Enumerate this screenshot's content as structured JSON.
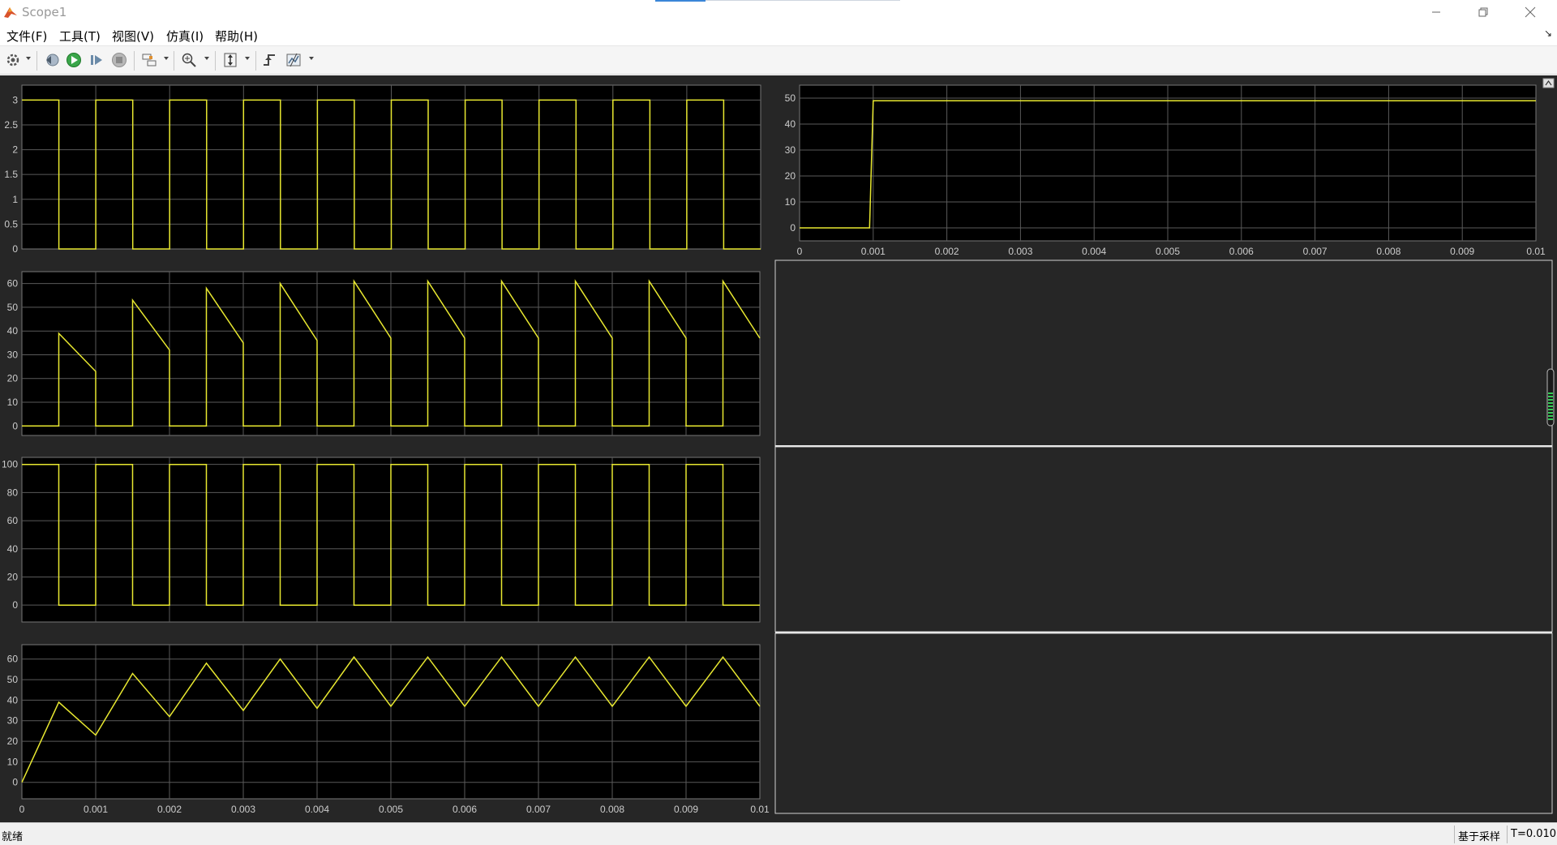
{
  "window": {
    "title": "Scope1"
  },
  "menu": [
    "文件(F)",
    "工具(T)",
    "视图(V)",
    "仿真(I)",
    "帮助(H)"
  ],
  "status": {
    "text": "就绪",
    "mode": "基于采样",
    "time": "T=0.010"
  },
  "colors": {
    "signal": "#e8e830",
    "axes_bg": "#000000",
    "grid": "#5a5a5a",
    "tick_text": "#cccccc",
    "figure_bg": "#262626"
  },
  "x_axis": {
    "range": [
      0,
      0.01
    ],
    "ticks": [
      "0",
      "0.001",
      "0.002",
      "0.003",
      "0.004",
      "0.005",
      "0.006",
      "0.007",
      "0.008",
      "0.009",
      "0.01"
    ]
  },
  "toolbar_icons": [
    "settings-icon",
    "step-back-icon",
    "run-icon",
    "step-forward-icon",
    "stop-icon",
    "highlight-icon",
    "zoom-icon",
    "autoscale-icon",
    "triggers-icon",
    "cursor-measure-icon"
  ],
  "chart_data": [
    {
      "type": "line",
      "description_kind": "square-wave",
      "yticks": [
        "0",
        "0.5",
        "1",
        "1.5",
        "2",
        "2.5",
        "3"
      ],
      "ylim": [
        0,
        3.3
      ],
      "x": [
        0,
        0.0005,
        0.0005,
        0.001,
        0.001,
        0.0015,
        0.0015,
        0.002,
        0.002,
        0.0025,
        0.0025,
        0.003,
        0.003,
        0.0035,
        0.0035,
        0.004,
        0.004,
        0.0045,
        0.0045,
        0.005,
        0.005,
        0.0055,
        0.0055,
        0.006,
        0.006,
        0.0065,
        0.0065,
        0.007,
        0.007,
        0.0075,
        0.0075,
        0.008,
        0.008,
        0.0085,
        0.0085,
        0.009,
        0.009,
        0.0095,
        0.0095,
        0.01
      ],
      "y": [
        3,
        3,
        0,
        0,
        3,
        3,
        0,
        0,
        3,
        3,
        0,
        0,
        3,
        3,
        0,
        0,
        3,
        3,
        0,
        0,
        3,
        3,
        0,
        0,
        3,
        3,
        0,
        0,
        3,
        3,
        0,
        0,
        3,
        3,
        0,
        0,
        3,
        3,
        0,
        0
      ]
    },
    {
      "type": "line",
      "yticks": [
        "0",
        "10",
        "20",
        "30",
        "40",
        "50",
        "60"
      ],
      "ylim": [
        -4,
        65
      ],
      "x": [
        0,
        0.0005,
        0.0005,
        0.001,
        0.001,
        0.0015,
        0.0015,
        0.002,
        0.002,
        0.0025,
        0.0025,
        0.003,
        0.003,
        0.0035,
        0.0035,
        0.004,
        0.004,
        0.0045,
        0.0045,
        0.005,
        0.005,
        0.0055,
        0.0055,
        0.006,
        0.006,
        0.0065,
        0.0065,
        0.007,
        0.007,
        0.0075,
        0.0075,
        0.008,
        0.008,
        0.0085,
        0.0085,
        0.009,
        0.009,
        0.0095,
        0.0095,
        0.01
      ],
      "y": [
        0,
        0,
        39,
        23,
        0,
        0,
        53,
        32,
        0,
        0,
        58,
        35,
        0,
        0,
        60,
        36,
        0,
        0,
        61,
        37,
        0,
        0,
        61,
        37,
        0,
        0,
        61,
        37,
        0,
        0,
        61,
        37,
        0,
        0,
        61,
        37,
        0,
        0,
        61,
        37
      ]
    },
    {
      "type": "line",
      "yticks": [
        "0",
        "20",
        "40",
        "60",
        "80",
        "100"
      ],
      "ylim": [
        -12,
        105
      ],
      "x": [
        0,
        0.0005,
        0.0005,
        0.001,
        0.001,
        0.0015,
        0.0015,
        0.002,
        0.002,
        0.0025,
        0.0025,
        0.003,
        0.003,
        0.0035,
        0.0035,
        0.004,
        0.004,
        0.0045,
        0.0045,
        0.005,
        0.005,
        0.0055,
        0.0055,
        0.006,
        0.006,
        0.0065,
        0.0065,
        0.007,
        0.007,
        0.0075,
        0.0075,
        0.008,
        0.008,
        0.0085,
        0.0085,
        0.009,
        0.009,
        0.0095,
        0.0095,
        0.01
      ],
      "y": [
        100,
        100,
        0,
        0,
        100,
        100,
        0,
        0,
        100,
        100,
        0,
        0,
        100,
        100,
        0,
        0,
        100,
        100,
        0,
        0,
        100,
        100,
        0,
        0,
        100,
        100,
        0,
        0,
        100,
        100,
        0,
        0,
        100,
        100,
        0,
        0,
        100,
        100,
        0,
        0
      ]
    },
    {
      "type": "line",
      "yticks": [
        "0",
        "10",
        "20",
        "30",
        "40",
        "50",
        "60"
      ],
      "ylim": [
        -8,
        67
      ],
      "show_xticks": true,
      "x": [
        0,
        0.0005,
        0.001,
        0.0015,
        0.002,
        0.0025,
        0.003,
        0.0035,
        0.004,
        0.0045,
        0.005,
        0.0055,
        0.006,
        0.0065,
        0.007,
        0.0075,
        0.008,
        0.0085,
        0.009,
        0.0095,
        0.01
      ],
      "y": [
        0,
        39,
        23,
        53,
        32,
        58,
        35,
        60,
        36,
        61,
        37,
        61,
        37,
        61,
        37,
        61,
        37,
        61,
        37,
        61,
        37
      ]
    },
    {
      "type": "line",
      "yticks": [
        "0",
        "10",
        "20",
        "30",
        "40",
        "50"
      ],
      "ylim": [
        -5,
        55
      ],
      "show_xticks": true,
      "x": [
        0,
        0.00095,
        0.001,
        0.01
      ],
      "y": [
        0,
        0,
        49,
        49
      ]
    }
  ]
}
